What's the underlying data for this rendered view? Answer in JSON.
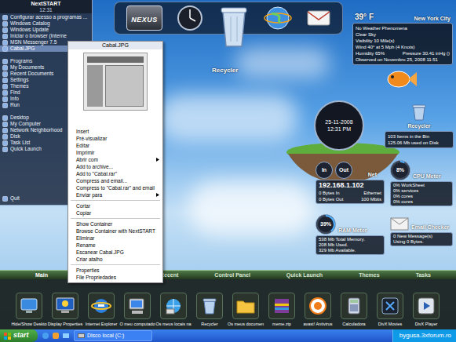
{
  "start_menu": {
    "title": "NextSTART",
    "time": "12:31",
    "groups": [
      [
        {
          "label": "Configurar acesso a programas ...",
          "selected": false
        },
        {
          "label": "Windows Catalog",
          "selected": false
        },
        {
          "label": "Windows Update",
          "selected": false
        },
        {
          "label": "Iniciar o browser (Interne",
          "selected": false
        },
        {
          "label": "MSN Messenger 7.5",
          "selected": false
        },
        {
          "label": "Cabal.JPG",
          "selected": true
        }
      ],
      [
        {
          "label": "Programs",
          "selected": false
        },
        {
          "label": "My Documents",
          "selected": false
        },
        {
          "label": "Recent Documents",
          "selected": false
        },
        {
          "label": "Settings",
          "selected": false
        },
        {
          "label": "Themes",
          "selected": false
        },
        {
          "label": "Find",
          "selected": false
        },
        {
          "label": "Info",
          "selected": false
        },
        {
          "label": "Run",
          "selected": false
        }
      ],
      [
        {
          "label": "Desktop",
          "selected": false
        },
        {
          "label": "My Computer",
          "selected": false
        },
        {
          "label": "Network Neighborhood",
          "selected": false
        },
        {
          "label": "Disk",
          "selected": false
        },
        {
          "label": "Task List",
          "selected": false
        },
        {
          "label": "Quick Launch",
          "selected": false
        }
      ]
    ],
    "quit": {
      "label": "Quit",
      "selected": false
    }
  },
  "context_menu": {
    "title": "Cabal.JPG",
    "items": [
      {
        "kind": "item",
        "label": "Insert",
        "submenu": false
      },
      {
        "kind": "item",
        "label": "Pré-visualizar",
        "submenu": false
      },
      {
        "kind": "item",
        "label": "Editar",
        "submenu": false
      },
      {
        "kind": "item",
        "label": "Imprimir",
        "submenu": false
      },
      {
        "kind": "item",
        "label": "Abrir com",
        "submenu": true
      },
      {
        "kind": "item",
        "label": "Add to archive...",
        "submenu": false
      },
      {
        "kind": "item",
        "label": "Add to \"Cabal.rar\"",
        "submenu": false
      },
      {
        "kind": "item",
        "label": "Compress and email...",
        "submenu": false
      },
      {
        "kind": "item",
        "label": "Compress to \"Cabal.rar\" and email",
        "submenu": false
      },
      {
        "kind": "item",
        "label": "Enviar para",
        "submenu": true
      },
      {
        "kind": "separator"
      },
      {
        "kind": "item",
        "label": "Cortar",
        "submenu": false
      },
      {
        "kind": "item",
        "label": "Copiar",
        "submenu": false
      },
      {
        "kind": "separator"
      },
      {
        "kind": "item",
        "label": "Show Container",
        "submenu": false
      },
      {
        "kind": "item",
        "label": "Browse Container with NextSTART",
        "submenu": false
      },
      {
        "kind": "item",
        "label": "Eliminar",
        "submenu": false
      },
      {
        "kind": "item",
        "label": "Rename",
        "submenu": false
      },
      {
        "kind": "item",
        "label": "Escanear Cabal.JPG",
        "submenu": false
      },
      {
        "kind": "item",
        "label": "Criar atalho",
        "submenu": false
      },
      {
        "kind": "separator"
      },
      {
        "kind": "item",
        "label": "Properties",
        "submenu": false
      },
      {
        "kind": "item",
        "label": "File Propriedades",
        "submenu": false
      }
    ]
  },
  "top_dock": {
    "logo": "NEXUS",
    "label": "Recycler"
  },
  "weather": {
    "temperature": "39° F",
    "city": "New York City",
    "lines": [
      "No Weather Phenomena",
      "Clear Sky",
      "Visibility 10 Mile(s)",
      "Wind 40° at 5 Mph (4 Knots)"
    ],
    "humidity": "Humidity 65%",
    "pressure": "Pressure 30.41 inHg ()",
    "observed": "Observed on Novembro 25, 2008 11:51"
  },
  "clock": {
    "date": "25-11-2008",
    "time": "12:31 PM"
  },
  "recycler": {
    "title": "Recycler",
    "lines": [
      "103 Items in the Bin",
      "125.06 Mb used on Disk"
    ]
  },
  "net": {
    "in_label": "In",
    "out_label": "Out",
    "title": "Net",
    "ip": "192.168.1.102",
    "rows": [
      [
        "0 Bytes In",
        "Ethernet"
      ],
      [
        "0 Bytes Out",
        "100 Mbits"
      ]
    ]
  },
  "cpu": {
    "reading": "8%",
    "level": 0.08,
    "title": "CPU Meter",
    "lines": [
      "0% WorkSheet",
      "0% services",
      "0% cores",
      "0% cores"
    ]
  },
  "ram": {
    "reading": "39%",
    "level": 0.39,
    "title": "RAM Meter",
    "lines": [
      "538 Mb Total Memory.",
      "208 Mb Used.",
      "329 Mb Available."
    ]
  },
  "email": {
    "title": "Email Checker",
    "lines": [
      "0 New Message(s)",
      "Using 0 Bytes."
    ]
  },
  "bottom_dock": {
    "tabs": [
      {
        "label": "Main",
        "selected": true
      },
      {
        "label": "Recent",
        "selected": false
      },
      {
        "label": "Control Panel",
        "selected": false
      },
      {
        "label": "Quick Launch",
        "selected": false
      },
      {
        "label": "Themes",
        "selected": false
      },
      {
        "label": "Tasks",
        "selected": false
      }
    ],
    "items": [
      {
        "label": "Hide/Show Deskto",
        "kind": "desktop"
      },
      {
        "label": "Display Properties",
        "kind": "display"
      },
      {
        "label": "Internet Explorer",
        "kind": "ie"
      },
      {
        "label": "O meu computado",
        "kind": "computer"
      },
      {
        "label": "Os meus locais na",
        "kind": "network"
      },
      {
        "label": "Recycler",
        "kind": "recycler"
      },
      {
        "label": "Os meus documen",
        "kind": "folder"
      },
      {
        "label": "meme.zip",
        "kind": "zip"
      },
      {
        "label": "avast! Antivirus",
        "kind": "antivirus"
      },
      {
        "label": "Calculadora",
        "kind": "calculator"
      },
      {
        "label": "DivX Movies",
        "kind": "divx"
      },
      {
        "label": "DivX Player",
        "kind": "player"
      }
    ]
  },
  "taskbar": {
    "start": "start",
    "tasks": [
      {
        "label": "Disco local (C:)",
        "selected": false
      }
    ],
    "watermark": "bygusa.3xforum.ro"
  }
}
